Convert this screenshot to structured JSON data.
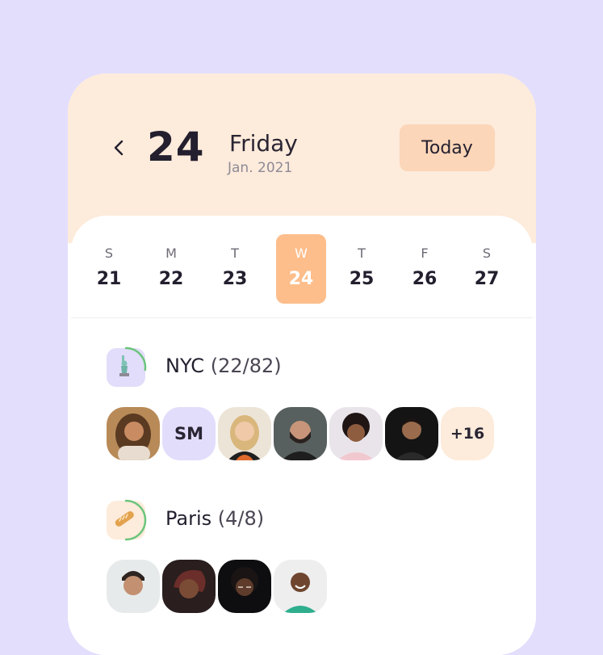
{
  "header": {
    "back_icon": "chevron-left-icon",
    "day_number": "24",
    "weekday": "Friday",
    "month_year": "Jan. 2021",
    "today_label": "Today"
  },
  "week": [
    {
      "letter": "S",
      "num": "21"
    },
    {
      "letter": "M",
      "num": "22"
    },
    {
      "letter": "T",
      "num": "23"
    },
    {
      "letter": "W",
      "num": "24",
      "selected": true
    },
    {
      "letter": "T",
      "num": "25"
    },
    {
      "letter": "F",
      "num": "26"
    },
    {
      "letter": "S",
      "num": "27"
    }
  ],
  "groups": [
    {
      "name": "NYC",
      "count": "(22/82)",
      "icon": "statue-of-liberty-icon",
      "progress": 0.27,
      "avatars": [
        {
          "type": "photo",
          "name": "avatar-photo"
        },
        {
          "type": "initials",
          "text": "SM"
        },
        {
          "type": "photo",
          "name": "avatar-photo"
        },
        {
          "type": "photo",
          "name": "avatar-photo"
        },
        {
          "type": "photo",
          "name": "avatar-photo"
        },
        {
          "type": "photo",
          "name": "avatar-photo"
        },
        {
          "type": "more",
          "text": "+16"
        }
      ]
    },
    {
      "name": "Paris",
      "count": "(4/8)",
      "icon": "baguette-icon",
      "progress": 0.5,
      "avatars": [
        {
          "type": "photo",
          "name": "avatar-photo"
        },
        {
          "type": "photo",
          "name": "avatar-photo"
        },
        {
          "type": "photo",
          "name": "avatar-photo"
        },
        {
          "type": "photo",
          "name": "avatar-photo"
        }
      ]
    }
  ],
  "colors": {
    "background": "#E3DEFC",
    "header_band": "#FDEBDB",
    "today_button": "#FBD6B8",
    "selected_day": "#FDBE8C",
    "progress_ring": "#6CC57C"
  }
}
